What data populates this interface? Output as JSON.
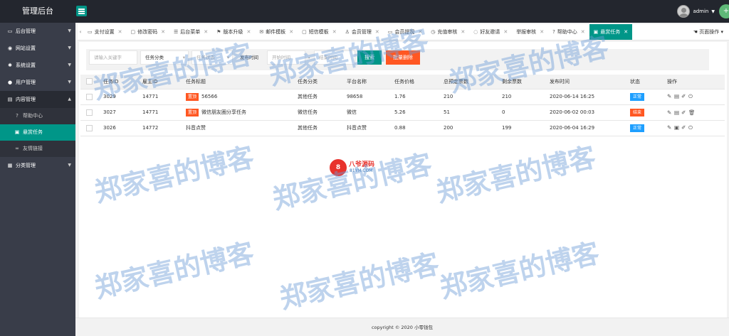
{
  "app": {
    "title": "管理后台"
  },
  "header": {
    "username": "admin",
    "add_symbol": "+"
  },
  "sidebar": {
    "items": [
      {
        "label": "后台管理",
        "icon": "monitor-icon"
      },
      {
        "label": "网站设置",
        "icon": "globe-icon"
      },
      {
        "label": "系统设置",
        "icon": "gear-icon"
      },
      {
        "label": "用户管理",
        "icon": "user-icon"
      },
      {
        "label": "内容管理",
        "icon": "document-icon",
        "sub": [
          {
            "label": "帮助中心",
            "icon": "question-icon"
          },
          {
            "label": "悬赏任务",
            "icon": "doc-icon"
          },
          {
            "label": "友情链接",
            "icon": "link-icon"
          }
        ]
      },
      {
        "label": "分类管理",
        "icon": "grid-icon"
      }
    ]
  },
  "tabs": [
    {
      "label": "支付设置",
      "icon": "folder-icon"
    },
    {
      "label": "修改密码",
      "icon": "lock-icon"
    },
    {
      "label": "后台菜单",
      "icon": "menu-icon"
    },
    {
      "label": "版本升级",
      "icon": "flag-icon"
    },
    {
      "label": "邮件模板",
      "icon": "mail-icon"
    },
    {
      "label": "短信模板",
      "icon": "chat-icon"
    },
    {
      "label": "会员管理",
      "icon": "user-icon"
    },
    {
      "label": "会员提现",
      "icon": "card-icon"
    },
    {
      "label": "充值审核",
      "icon": "search-icon"
    },
    {
      "label": "好友邀请",
      "icon": "share-icon"
    },
    {
      "label": "举报审核",
      "icon": "warn-icon"
    },
    {
      "label": "帮助中心",
      "icon": "question-icon"
    },
    {
      "label": "悬赏任务",
      "icon": "doc-icon",
      "active": true
    }
  ],
  "page_ops_label": "页面操作",
  "filters": {
    "keyword_placeholder": "请输入关键字",
    "category_label": "任务分类",
    "status_label": "任务状态",
    "time_label": "发布时间",
    "start_placeholder": "开始时间",
    "dash": "-",
    "end_placeholder": "结束时间",
    "search_label": "搜索",
    "batch_delete_label": "批量删除"
  },
  "table": {
    "headers": [
      "任务ID",
      "雇主ID",
      "任务标题",
      "任务分类",
      "平台名称",
      "任务价格",
      "总预定票数",
      "剩余票数",
      "发布时间",
      "状态",
      "操作"
    ],
    "rows": [
      {
        "id": "3029",
        "employer": "14771",
        "tag": "置顶",
        "title": "56566",
        "category": "其他任务",
        "platform": "98658",
        "price": "1.76",
        "total": "210",
        "remaining": "210",
        "time": "2020-06-14 16:25",
        "status": "正常",
        "status_color": "#1e9fff"
      },
      {
        "id": "3027",
        "employer": "14771",
        "tag": "置顶",
        "title": "微信朋友圈分享任务",
        "category": "微信任务",
        "platform": "微信",
        "price": "5.26",
        "total": "51",
        "remaining": "0",
        "time": "2020-06-02 00:03",
        "status": "结束",
        "status_color": "#ff5722"
      },
      {
        "id": "3026",
        "employer": "14772",
        "tag": "",
        "title": "抖音点赞",
        "category": "其他任务",
        "platform": "抖音点赞",
        "price": "0.88",
        "total": "200",
        "remaining": "199",
        "time": "2020-06-04 16:29",
        "status": "正常",
        "status_color": "#1e9fff"
      }
    ]
  },
  "brand": {
    "mark": "8",
    "cn": "八爷源码",
    "en": "81YM.COM"
  },
  "footer": {
    "copyright": "copyright © 2020 小零钱包"
  },
  "watermark": "郑家喜的博客"
}
